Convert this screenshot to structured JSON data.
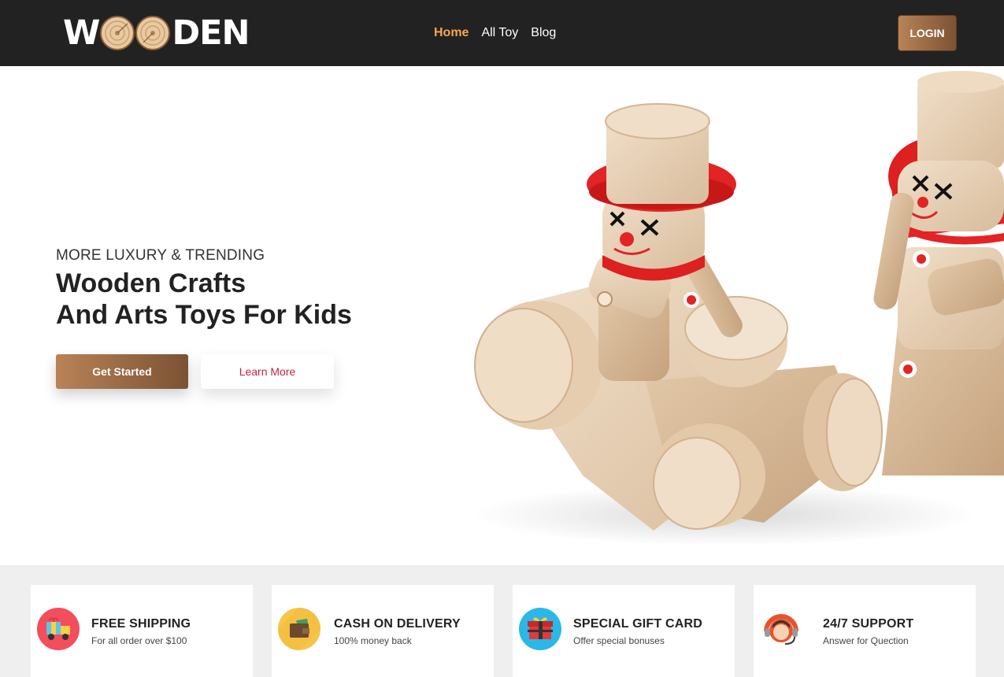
{
  "header": {
    "logo": {
      "part1": "W",
      "part2": "DEN"
    },
    "nav": [
      {
        "label": "Home",
        "active": true
      },
      {
        "label": "All Toy",
        "active": false
      },
      {
        "label": "Blog",
        "active": false
      }
    ],
    "login_label": "LOGIN"
  },
  "hero": {
    "subtitle": "MORE LUXURY & TRENDING",
    "title_line1": "Wooden Crafts",
    "title_line2": "And Arts Toys For Kids",
    "primary_button": "Get Started",
    "secondary_button": "Learn More"
  },
  "features": [
    {
      "title": "FREE SHIPPING",
      "desc": "For all order over $100",
      "icon": "delivery-truck-icon"
    },
    {
      "title": "CASH ON DELIVERY",
      "desc": "100% money back",
      "icon": "wallet-icon"
    },
    {
      "title": "SPECIAL GIFT CARD",
      "desc": "Offer special bonuses",
      "icon": "gift-icon"
    },
    {
      "title": "24/7 SUPPORT",
      "desc": "Answer for Quection",
      "icon": "support-agent-icon"
    }
  ],
  "colors": {
    "header_bg": "#222222",
    "nav_active": "#F7A64E",
    "accent_gradient_start": "#B98356",
    "accent_gradient_end": "#7B5234",
    "learn_more_text": "#C8233D",
    "features_bg": "#efefef"
  }
}
